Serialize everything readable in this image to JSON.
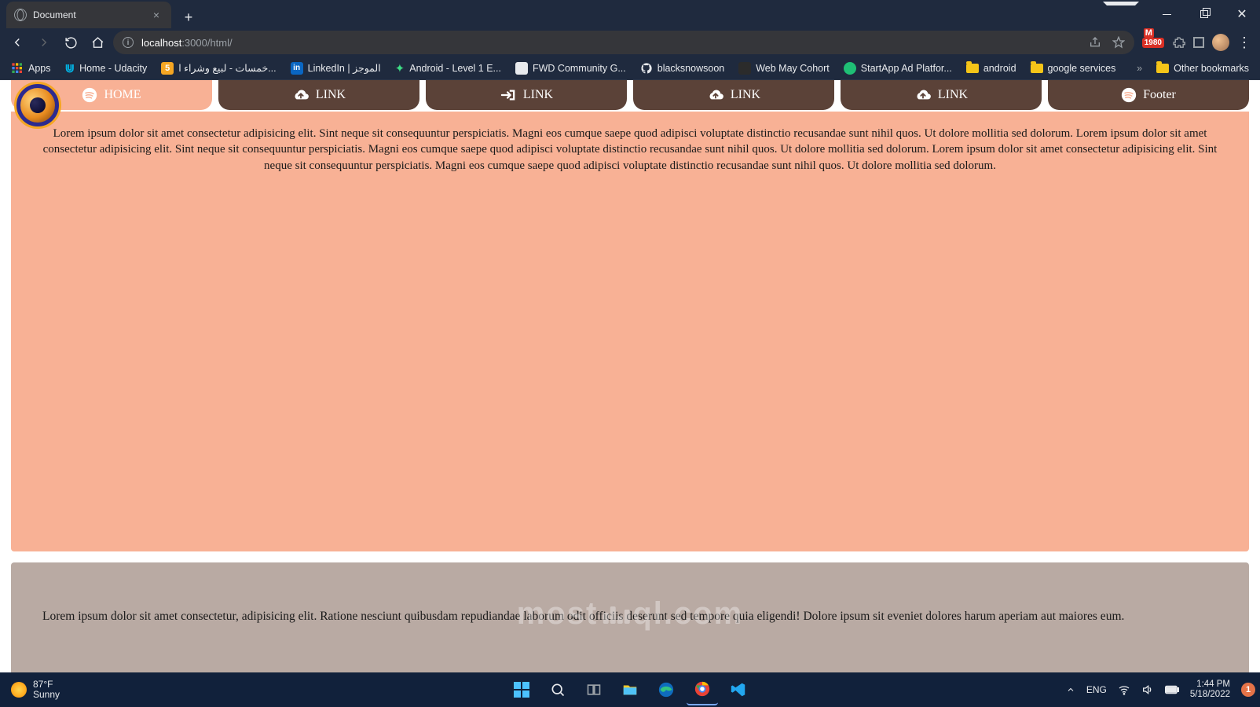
{
  "browser": {
    "tab_title": "Document",
    "url_host": "localhost",
    "url_port_path": ":3000/html/",
    "ext_badge": "1980"
  },
  "bookmarks": [
    {
      "label": "Apps",
      "kind": "grid"
    },
    {
      "label": "Home - Udacity",
      "kind": "u"
    },
    {
      "label": "خمسات - لبيع وشراء ا...",
      "kind": "sq-orange"
    },
    {
      "label": "LinkedIn | الموجز",
      "kind": "in"
    },
    {
      "label": "Android - Level 1 E...",
      "kind": "and"
    },
    {
      "label": "FWD Community G...",
      "kind": "doc"
    },
    {
      "label": "blacksnowsoon",
      "kind": "gh"
    },
    {
      "label": "Web May Cohort",
      "kind": "sq-dark"
    },
    {
      "label": "StartApp Ad Platfor...",
      "kind": "circ"
    },
    {
      "label": "android",
      "kind": "folder"
    },
    {
      "label": "google services",
      "kind": "folder"
    }
  ],
  "bookmarks_overflow": "»",
  "bookmarks_other": "Other bookmarks",
  "nav": {
    "items": [
      {
        "label": "HOME",
        "icon": "spotify",
        "style": "light"
      },
      {
        "label": "LINK",
        "icon": "cloud-up",
        "style": "dark"
      },
      {
        "label": "LINK",
        "icon": "login",
        "style": "dark"
      },
      {
        "label": "LINK",
        "icon": "cloud-up",
        "style": "dark"
      },
      {
        "label": "LINK",
        "icon": "cloud-up",
        "style": "dark"
      },
      {
        "label": "Footer",
        "icon": "spotify",
        "style": "dark"
      }
    ]
  },
  "section1_text": "Lorem ipsum dolor sit amet consectetur adipisicing elit. Sint neque sit consequuntur perspiciatis. Magni eos cumque saepe quod adipisci voluptate distinctio recusandae sunt nihil quos. Ut dolore mollitia sed dolorum. Lorem ipsum dolor sit amet consectetur adipisicing elit. Sint neque sit consequuntur perspiciatis. Magni eos cumque saepe quod adipisci voluptate distinctio recusandae sunt nihil quos. Ut dolore mollitia sed dolorum. Lorem ipsum dolor sit amet consectetur adipisicing elit. Sint neque sit consequuntur perspiciatis. Magni eos cumque saepe quod adipisci voluptate distinctio recusandae sunt nihil quos. Ut dolore mollitia sed dolorum.",
  "section2_text": "Lorem ipsum dolor sit amet consectetur, adipisicing elit. Ratione nesciunt quibusdam repudiandae laborum odit officiis deserunt sed tempore quia eligendi! Dolore ipsum sit eveniet dolores harum aperiam aut maiores eum.",
  "watermark": {
    "left": "most",
    "right": "ql.com"
  },
  "taskbar": {
    "temp": "87°F",
    "cond": "Sunny",
    "lang": "ENG",
    "time": "1:44 PM",
    "date": "5/18/2022",
    "notif_count": "1"
  }
}
